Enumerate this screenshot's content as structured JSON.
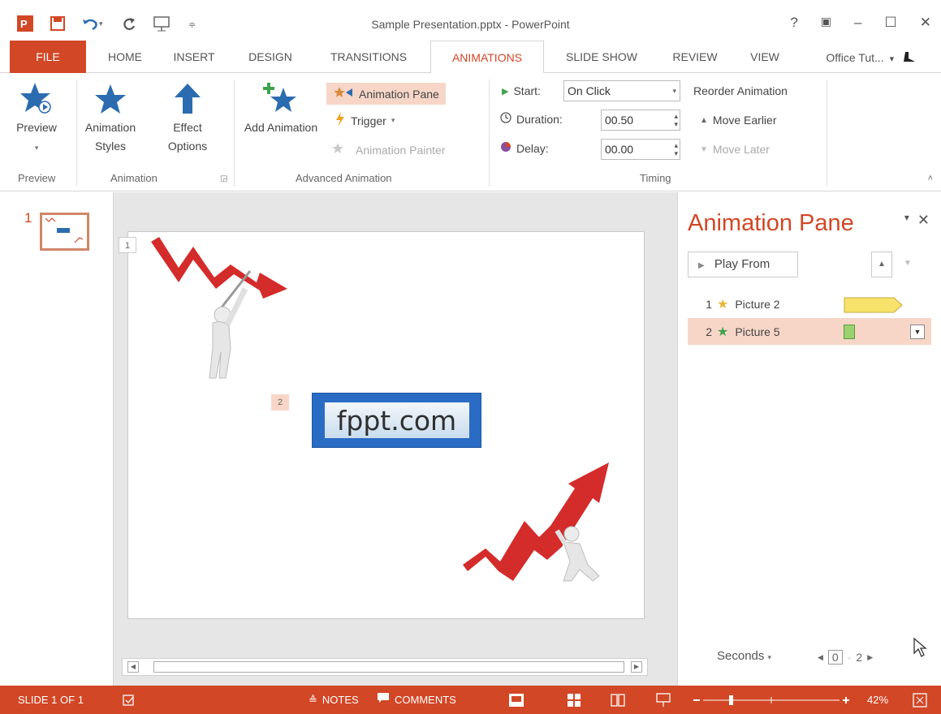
{
  "window": {
    "title": "Sample Presentation.pptx - PowerPoint",
    "controls": [
      "?",
      "▣",
      "–",
      "☐",
      "✕"
    ]
  },
  "tabs": {
    "file": "FILE",
    "items": [
      "HOME",
      "INSERT",
      "DESIGN",
      "TRANSITIONS",
      "ANIMATIONS",
      "SLIDE SHOW",
      "REVIEW",
      "VIEW"
    ],
    "active": "ANIMATIONS",
    "account": "Office Tut...",
    "account_chevron": "▾"
  },
  "ribbon": {
    "preview": {
      "button": "Preview",
      "group": "Preview"
    },
    "animation": {
      "styles": "Animation Styles",
      "effect": "Effect Options",
      "group": "Animation"
    },
    "advanced": {
      "add": "Add Animation",
      "pane": "Animation Pane",
      "trigger": "Trigger",
      "painter": "Animation Painter",
      "group": "Advanced Animation"
    },
    "timing": {
      "start_label": "Start:",
      "start_value": "On Click",
      "duration_label": "Duration:",
      "duration_value": "00.50",
      "delay_label": "Delay:",
      "delay_value": "00.00",
      "reorder": "Reorder Animation",
      "earlier": "Move Earlier",
      "later": "Move Later",
      "group": "Timing"
    }
  },
  "thumbnails": {
    "number": "1"
  },
  "slide": {
    "tag1": "1",
    "tag2": "2",
    "logo_text": "fppt.com"
  },
  "pane": {
    "title": "Animation Pane",
    "play_from": "Play From",
    "items": [
      {
        "num": "1",
        "name": "Picture 2"
      },
      {
        "num": "2",
        "name": "Picture 5"
      }
    ],
    "seconds": "Seconds",
    "timeline_start": "0",
    "timeline_end": "2"
  },
  "status": {
    "slide": "SLIDE 1 OF 1",
    "notes": "NOTES",
    "comments": "COMMENTS",
    "zoom": "42%"
  },
  "colors": {
    "accent": "#d24726",
    "highlight": "#f7d6c8",
    "bar1": "#f7e36b",
    "bar2": "#9bd16f"
  }
}
